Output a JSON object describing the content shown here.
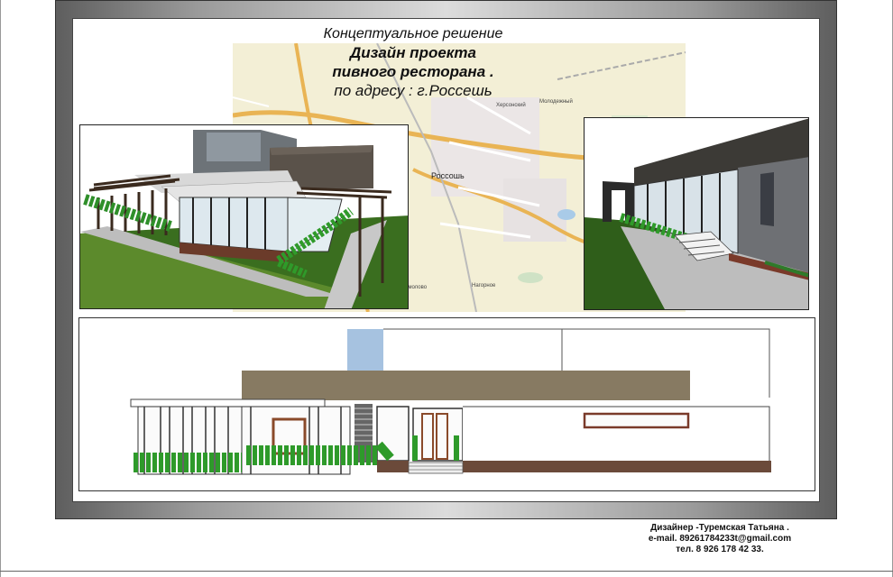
{
  "title": {
    "line1": "Концептуальное решение",
    "line2": "Дизайн проекта",
    "line3": "пивного  ресторана .",
    "line4": "по адресу : г.Россешь"
  },
  "map": {
    "city_label": "Россошь",
    "labels": [
      "Молодежный",
      "Херсонский",
      "Нагорное",
      "Смолово"
    ]
  },
  "credits": {
    "designer": "Дизайнер -Туремская Татьяна .",
    "email": "e-mail. 89261784233t@gmail.com",
    "phone": "тел. 8 926 178 42 33."
  }
}
